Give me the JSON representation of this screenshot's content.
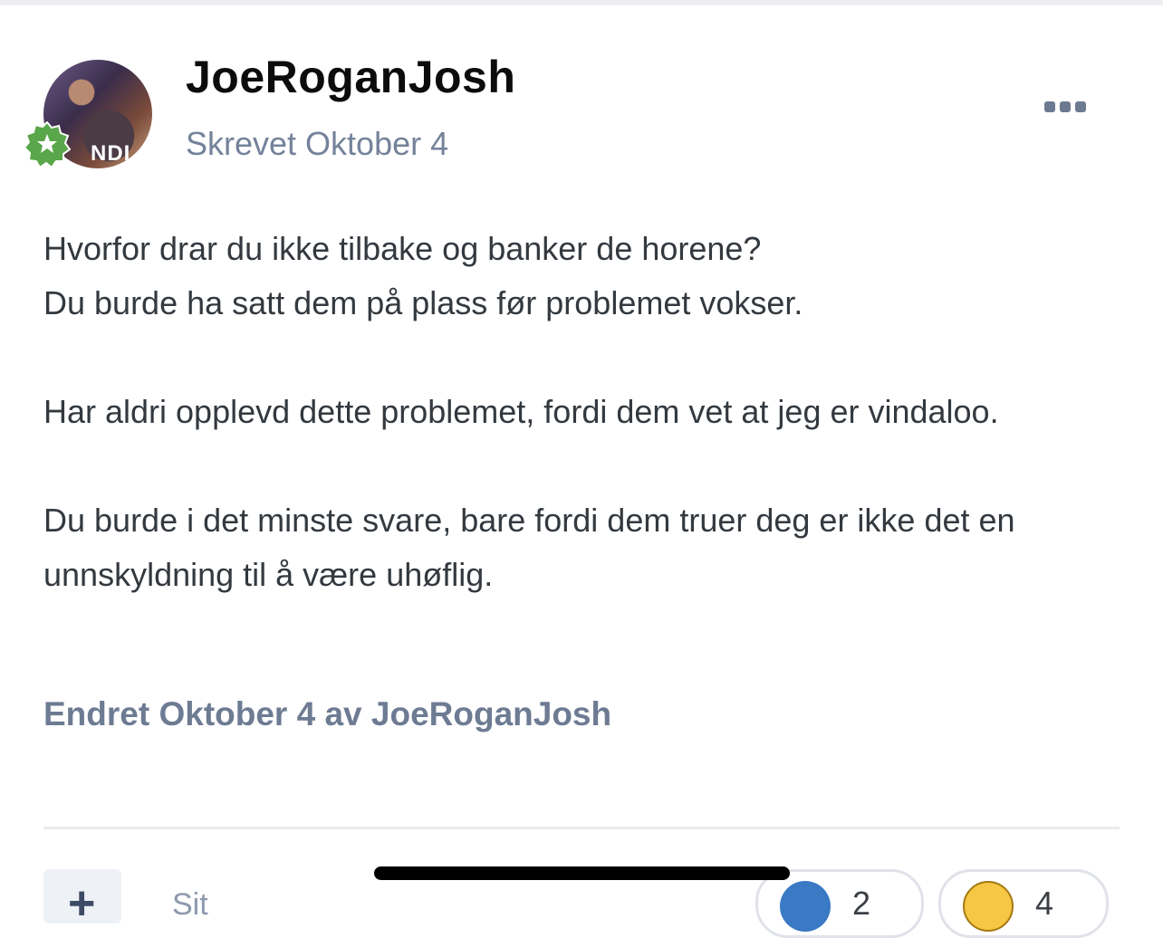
{
  "post": {
    "author": "JoeRoganJosh",
    "avatar_text": "NDI",
    "posted_label": "Skrevet Oktober 4",
    "paragraphs": [
      [
        "Hvorfor drar du ikke tilbake og banker de horene?",
        "Du burde ha satt dem på plass før problemet vokser."
      ],
      [
        "Har aldri opplevd dette problemet, fordi dem vet at jeg er vindaloo."
      ],
      [
        "Du burde i det minste svare, bare fordi dem truer deg er ikke det en unnskyldning til å være uhøflig."
      ]
    ],
    "edited_label": "Endret Oktober 4 av JoeRoganJosh"
  },
  "actions": {
    "add_label": "+",
    "quote_label": "Sit"
  },
  "reactions": [
    {
      "name": "like",
      "icon": "heart-icon",
      "count": "2"
    },
    {
      "name": "haha",
      "icon": "laughing-face-icon",
      "count": "4"
    }
  ],
  "icons": {
    "more": "more-dots-icon",
    "rank": "star-badge-icon"
  },
  "colors": {
    "meta_text": "#74829a",
    "edited_text": "#6d7b93",
    "badge_green": "#5aa64a",
    "like_blue": "#3a79c4",
    "haha_yellow": "#f6c744"
  }
}
